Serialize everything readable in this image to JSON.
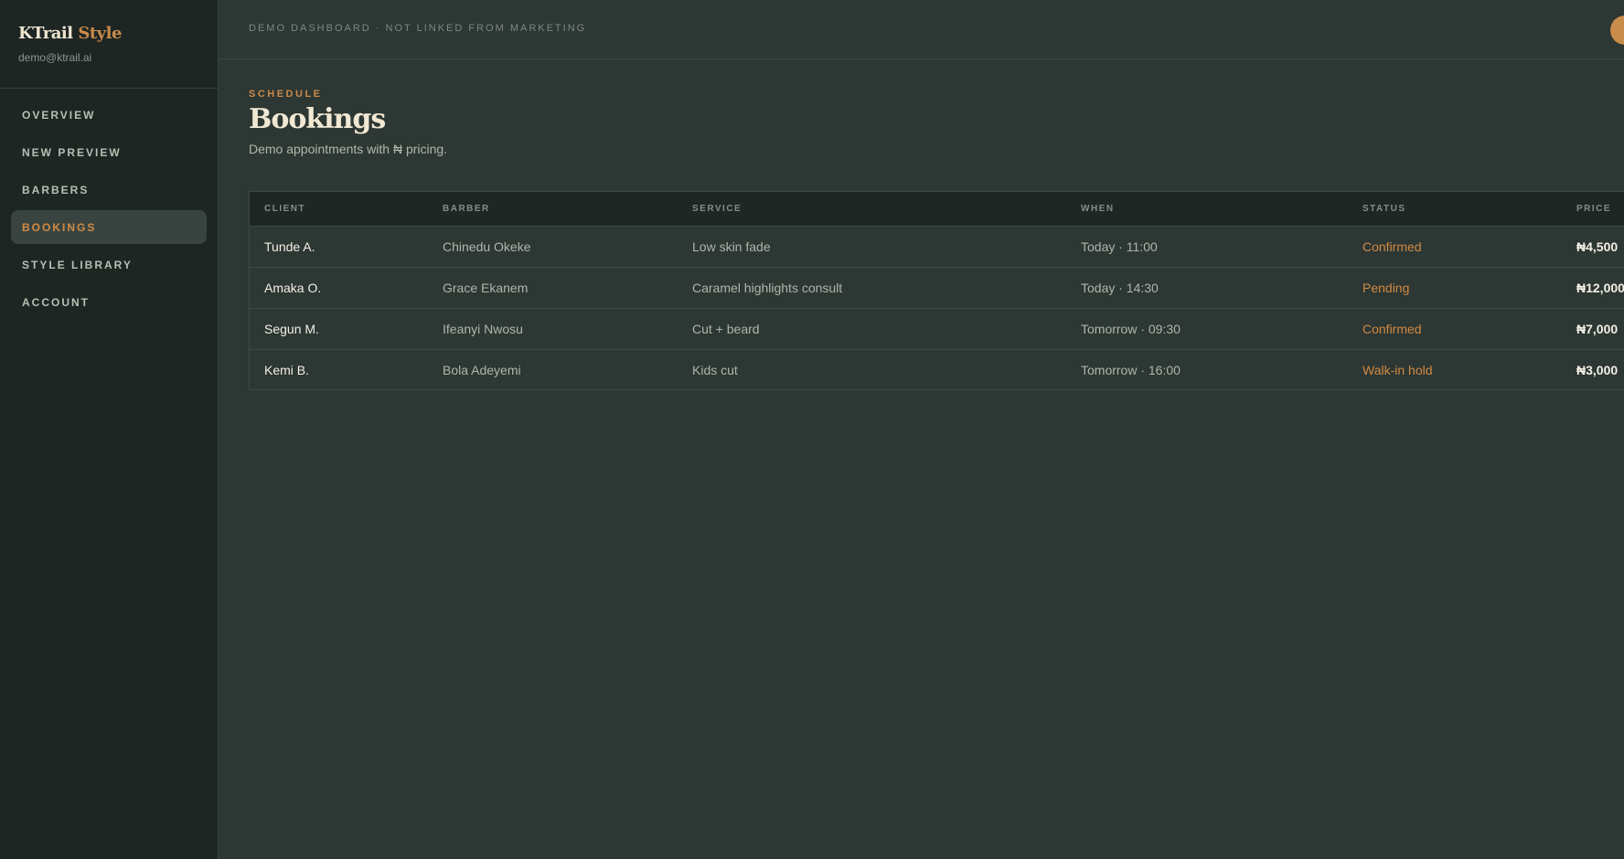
{
  "brand": {
    "name_a": "KTrail",
    "name_b": "Style",
    "email": "demo@ktrail.ai"
  },
  "nav": [
    {
      "label": "OVERVIEW",
      "active": false
    },
    {
      "label": "NEW PREVIEW",
      "active": false
    },
    {
      "label": "BARBERS",
      "active": false
    },
    {
      "label": "BOOKINGS",
      "active": true
    },
    {
      "label": "STYLE LIBRARY",
      "active": false
    },
    {
      "label": "ACCOUNT",
      "active": false
    }
  ],
  "topbar": {
    "note": "DEMO DASHBOARD · NOT LINKED FROM MARKETING"
  },
  "page": {
    "eyebrow": "SCHEDULE",
    "title": "Bookings",
    "subtitle": "Demo appointments with ₦ pricing."
  },
  "table": {
    "headers": {
      "client": "CLIENT",
      "barber": "BARBER",
      "service": "SERVICE",
      "when": "WHEN",
      "status": "STATUS",
      "price": "PRICE"
    },
    "rows": [
      {
        "client": "Tunde A.",
        "barber": "Chinedu Okeke",
        "service": "Low skin fade",
        "when": "Today · 11:00",
        "status": "Confirmed",
        "price": "₦4,500"
      },
      {
        "client": "Amaka O.",
        "barber": "Grace Ekanem",
        "service": "Caramel highlights consult",
        "when": "Today · 14:30",
        "status": "Pending",
        "price": "₦12,000"
      },
      {
        "client": "Segun M.",
        "barber": "Ifeanyi Nwosu",
        "service": "Cut + beard",
        "when": "Tomorrow · 09:30",
        "status": "Confirmed",
        "price": "₦7,000"
      },
      {
        "client": "Kemi B.",
        "barber": "Bola Adeyemi",
        "service": "Kids cut",
        "when": "Tomorrow · 16:00",
        "status": "Walk-in hold",
        "price": "₦3,000"
      }
    ]
  },
  "colors": {
    "accent": "#c98a4b",
    "background": "#2d3733",
    "sidebar": "#1e2624"
  }
}
